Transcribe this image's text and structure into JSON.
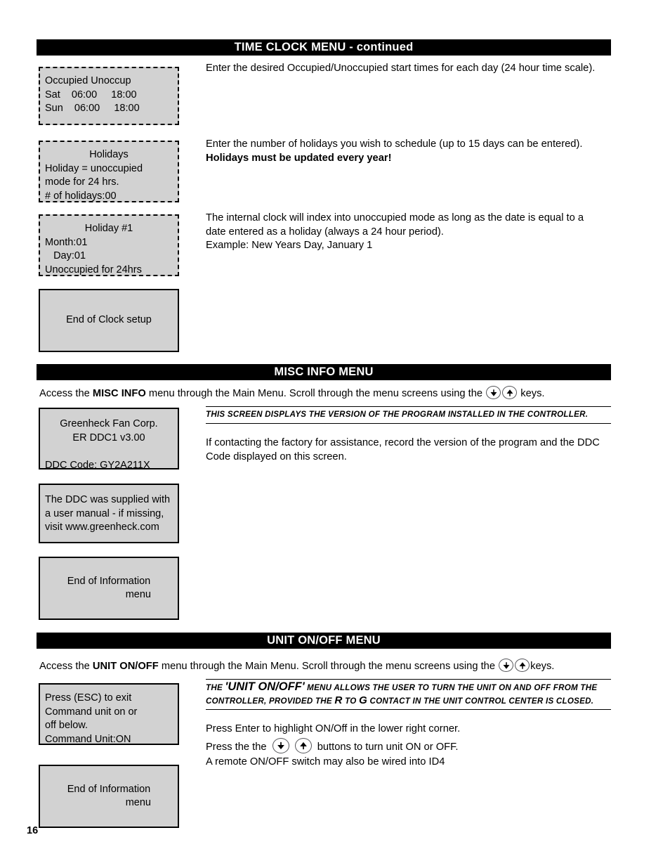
{
  "page": {
    "number": "16"
  },
  "sections": [
    {
      "id": "time-clock",
      "header_main": "TIME CLOCK MENU",
      "header_suffix": " - continued"
    },
    {
      "id": "misc-info",
      "header_main": "MISC INFO MENU"
    },
    {
      "id": "unit-on-off",
      "header_main": "UNIT ON/OFF MENU"
    }
  ],
  "time_clock": {
    "screens": [
      {
        "name": "occupied-unoccupied-schedule",
        "lines": [
          "Occupied Unoccup",
          "Sat    06:00     18:00",
          "Sun    06:00     18:00"
        ]
      },
      {
        "name": "holidays-count",
        "title": "Holidays",
        "lines": [
          "Holiday = unoccupied",
          "mode for 24 hrs.",
          "# of holidays:00"
        ]
      },
      {
        "name": "holiday-1",
        "title": "Holiday #1",
        "lines": [
          "Month:01",
          "   Day:01",
          "Unoccupied for 24hrs"
        ]
      },
      {
        "name": "end-of-clock-setup",
        "lines": [
          "End of Clock setup"
        ]
      }
    ],
    "notes": [
      {
        "name": "schedule-note",
        "text": "Enter the desired Occupied/Unoccupied start times for each day (24 hour time scale)."
      },
      {
        "name": "holidays-note",
        "text": "Enter the number of holidays you wish to schedule (up to 15 days can be entered).",
        "emphasis": "Holidays must be updated every year!"
      },
      {
        "name": "holiday-index-note",
        "line1": "The internal clock will index into unoccupied mode as long as the date is equal to a",
        "line2": "date entered as a holiday (always a 24 hour period).",
        "line3": "Example: New Years Day, January 1"
      }
    ]
  },
  "misc_info": {
    "access_prefix": "Access the ",
    "access_bold": "MISC INFO",
    "access_middle": " menu through the Main Menu. Scroll through the menu screens using the ",
    "access_suffix": " keys.",
    "screens": [
      {
        "name": "version-screen",
        "lines": [
          "Greenheck Fan Corp.",
          "ER DDC1 v3.00",
          "",
          "DDC Code: GY2A211X"
        ]
      },
      {
        "name": "user-manual-screen",
        "lines": [
          "The DDC was supplied with",
          "a user manual - if missing,",
          "visit www.greenheck.com"
        ]
      },
      {
        "name": "end-of-information-menu",
        "lines": [
          "End of Information",
          "menu"
        ]
      }
    ],
    "emphasis": "This screen displays the version of the program installed in the controller.",
    "note_line1": "If contacting the factory for assistance, record the version of the program and the DDC",
    "note_line2": "Code displayed on this screen."
  },
  "unit_on_off": {
    "access_prefix": "Access the ",
    "access_bold": "UNIT ON/OFF",
    "access_middle": " menu through the Main Menu. Scroll through the menu screens using the ",
    "access_suffix": "keys.",
    "screens": [
      {
        "name": "command-unit-screen",
        "lines": [
          "Press (ESC) to exit",
          "Command unit on or",
          "off below.",
          "Command Unit:ON"
        ]
      },
      {
        "name": "end-of-information-menu",
        "lines": [
          "End of Information",
          "menu"
        ]
      }
    ],
    "emphasis_part1": "The ",
    "emphasis_quoted": "'UNIT ON/OFF'",
    "emphasis_part2": " menu allows the user to turn the unit on and off from the controller, provided the ",
    "emphasis_r": "R",
    "emphasis_part3": " to ",
    "emphasis_g": "G",
    "emphasis_part4": " contact in the unit control center is closed.",
    "instructions": [
      "Press Enter to highlight ON/Off in the lower right corner.",
      "A remote ON/OFF switch may also be wired into ID4"
    ],
    "press_buttons_prefix": "Press the the ",
    "press_buttons_suffix": " buttons to turn unit ON or OFF."
  },
  "icons": {
    "down_arrow_key": "arrow-down-key-icon",
    "up_arrow_key": "arrow-up-key-icon"
  },
  "colors": {
    "lcd_background": "#d2d2d2",
    "header_bar": "#000000",
    "header_text": "#ffffff",
    "page_background": "#ffffff"
  }
}
